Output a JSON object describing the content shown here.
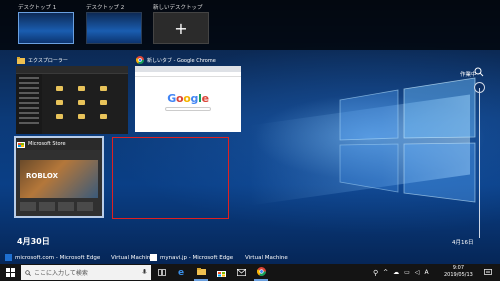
{
  "desktops": [
    {
      "label": "デスクトップ 1",
      "active": true
    },
    {
      "label": "デスクトップ 2",
      "active": false
    },
    {
      "label": "新しいデスクトップ",
      "thumb": "+"
    }
  ],
  "windows": {
    "explorer": {
      "title": "エクスプローラー",
      "icon": "folder-icon"
    },
    "chrome": {
      "title": "新しいタブ - Google Chrome",
      "icon": "chrome-icon",
      "logo": "Google"
    },
    "store": {
      "title": "Microsoft Store",
      "icon": "store-icon",
      "banner": "ROBLOX"
    }
  },
  "timeline": {
    "now_label": "作業中",
    "date_left": "4月30日",
    "date_right": "4月16日"
  },
  "activity": [
    {
      "label": "microsoft.com - Microsoft Edge",
      "icon": "edge-icon"
    },
    {
      "label": "Virtual Machine",
      "icon": ""
    },
    {
      "label": "mynavi.jp - Microsoft Edge",
      "icon": "mynavi-icon"
    },
    {
      "label": "Virtual Machine",
      "icon": ""
    }
  ],
  "taskbar": {
    "search_placeholder": "ここに入力して検索",
    "time": "9:07",
    "date": "2019/05/13"
  },
  "colors": {
    "highlight": "#e02020",
    "accent": "#6aa0e0"
  }
}
